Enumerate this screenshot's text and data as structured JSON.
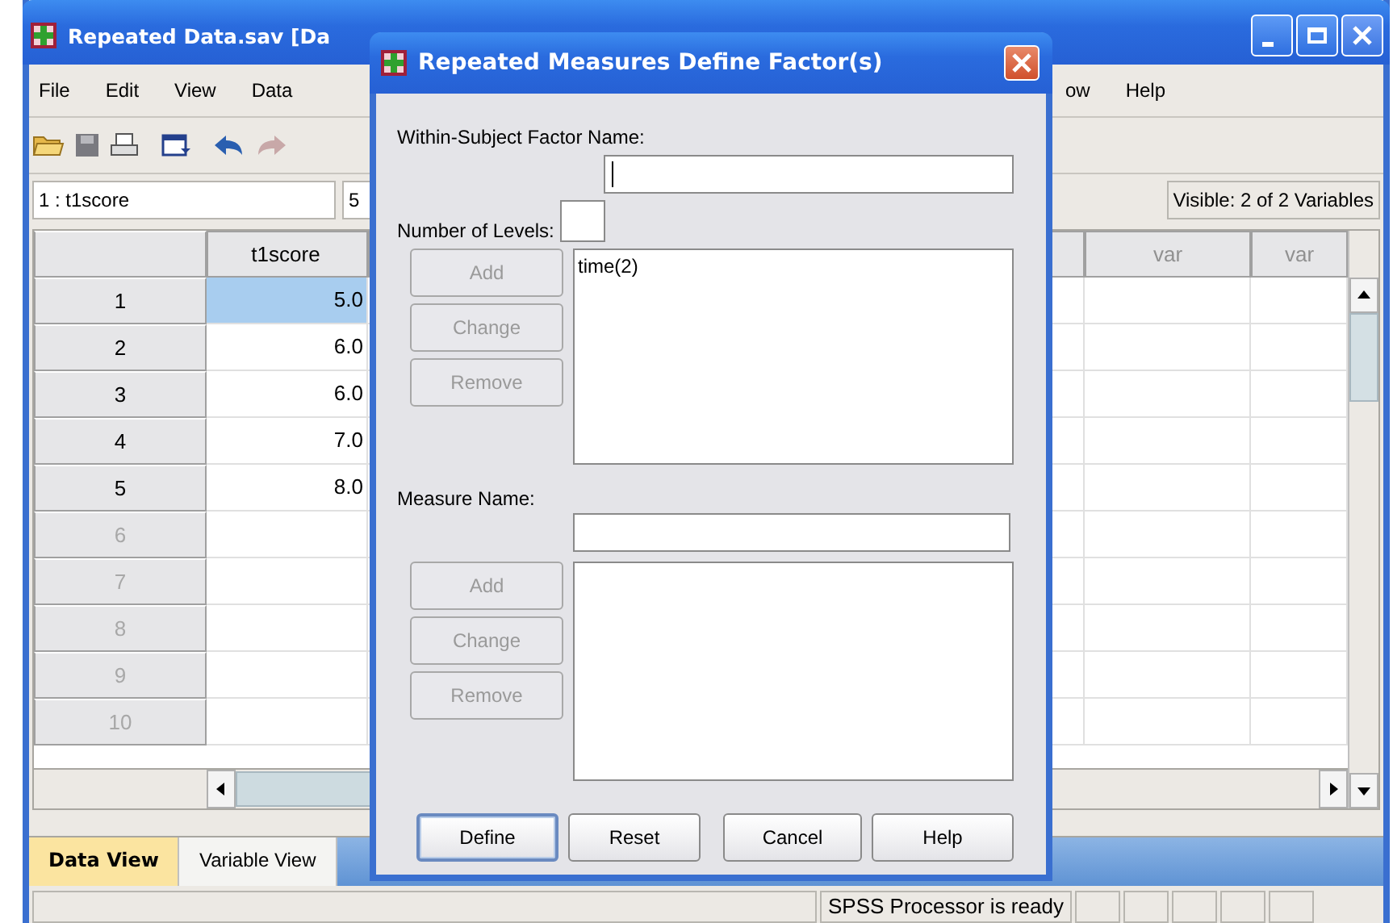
{
  "window": {
    "title": "Repeated Data.sav [Da"
  },
  "menu": [
    "File",
    "Edit",
    "View",
    "Data",
    "ow",
    "Help"
  ],
  "cell_editor": {
    "reference": "1 : t1score",
    "value": "5"
  },
  "visible_count": "Visible: 2 of 2 Variables",
  "table": {
    "columns": [
      {
        "label": "t1score",
        "disabled": false
      },
      {
        "label": "var",
        "disabled": true
      },
      {
        "label": "var",
        "disabled": true
      }
    ],
    "rows": [
      {
        "number": "1",
        "t1score": "5.0",
        "selected": true,
        "disabled": false
      },
      {
        "number": "2",
        "t1score": "6.0",
        "selected": false,
        "disabled": false
      },
      {
        "number": "3",
        "t1score": "6.0",
        "selected": false,
        "disabled": false
      },
      {
        "number": "4",
        "t1score": "7.0",
        "selected": false,
        "disabled": false
      },
      {
        "number": "5",
        "t1score": "8.0",
        "selected": false,
        "disabled": false
      },
      {
        "number": "6",
        "selected": false,
        "disabled": true
      },
      {
        "number": "7",
        "selected": false,
        "disabled": true
      },
      {
        "number": "8",
        "selected": false,
        "disabled": true
      },
      {
        "number": "9",
        "selected": false,
        "disabled": true
      },
      {
        "number": "10",
        "selected": false,
        "disabled": true
      }
    ]
  },
  "view_tabs": [
    {
      "label": "Data View",
      "selected": true
    },
    {
      "label": "Variable View",
      "selected": false
    }
  ],
  "status_bar": "SPSS Processor is ready",
  "dialog": {
    "title": "Repeated Measures Define Factor(s)",
    "factor_name": {
      "label": "Within-Subject Factor Name:",
      "focused": true
    },
    "levels": {
      "label": "Number of Levels:"
    },
    "factor_buttons": [
      {
        "label": "Add",
        "disabled": true
      },
      {
        "label": "Change",
        "disabled": true
      },
      {
        "label": "Remove",
        "disabled": true
      }
    ],
    "factor_list": [
      "time(2)"
    ],
    "measure": {
      "label": "Measure Name:"
    },
    "measure_buttons": [
      {
        "label": "Add",
        "disabled": true
      },
      {
        "label": "Change",
        "disabled": true
      },
      {
        "label": "Remove",
        "disabled": true
      }
    ],
    "buttons": [
      {
        "label": "Define",
        "default": true
      },
      {
        "label": "Reset",
        "default": false
      },
      {
        "label": "Cancel",
        "default": false
      },
      {
        "label": "Help",
        "default": false
      }
    ]
  }
}
